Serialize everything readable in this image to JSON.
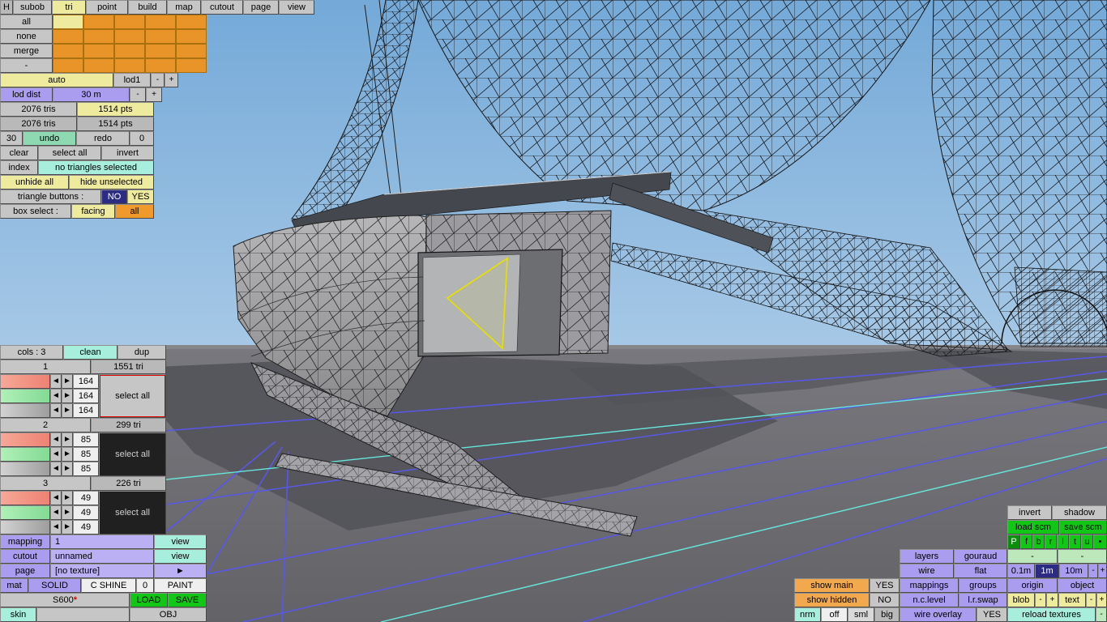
{
  "colors": {
    "sky": "#79add9",
    "ground": "#6a6a6f",
    "accent_orange": "#ef9a2a",
    "accent_violet": "#aa9cee",
    "accent_yellow": "#efeb9e",
    "accent_cyan": "#a8eedd",
    "accent_green": "#12c616",
    "selection_yellow": "#e6df00",
    "grid_blue": "#5858e8",
    "grid_cyan": "#66e6dc"
  },
  "menu": {
    "h": "H",
    "items": [
      "subob",
      "tri",
      "point",
      "build",
      "map",
      "cutout",
      "page",
      "view"
    ]
  },
  "subobj": {
    "buttons": [
      "all",
      "none",
      "merge",
      "-"
    ]
  },
  "lod": {
    "auto": "auto",
    "level": "lod1",
    "minus": "-",
    "plus": "+",
    "dist_label": "lod dist",
    "dist_value": "30 m"
  },
  "stats": {
    "row1": {
      "tris": "2076 tris",
      "pts": "1514 pts"
    },
    "row2": {
      "tris": "2076 tris",
      "pts": "1514 pts"
    }
  },
  "history": {
    "undo_count": "30",
    "undo": "undo",
    "redo": "redo",
    "redo_count": "0"
  },
  "selection": {
    "clear": "clear",
    "select_all": "select all",
    "invert": "invert",
    "index": "index",
    "status": "no triangles selected",
    "unhide_all": "unhide all",
    "hide_unselected": "hide unselected",
    "triangle_buttons_label": "triangle buttons :",
    "no": "NO",
    "yes": "YES",
    "box_select_label": "box select :",
    "facing": "facing",
    "all": "all"
  },
  "groups_panel": {
    "cols": "cols : 3",
    "clean": "clean",
    "dup": "dup",
    "arrow_left": "◄",
    "arrow_right": "►",
    "groups": [
      {
        "id": "1",
        "tri": "1551 tri",
        "values": [
          "164",
          "164",
          "164"
        ],
        "select_all": "select all"
      },
      {
        "id": "2",
        "tri": "299 tri",
        "values": [
          "85",
          "85",
          "85"
        ],
        "select_all": "select all"
      },
      {
        "id": "3",
        "tri": "226 tri",
        "values": [
          "49",
          "49",
          "49"
        ],
        "select_all": "select all"
      }
    ]
  },
  "mapping_rows": {
    "mapping_label": "mapping",
    "mapping_value": "1",
    "view": "view",
    "cutout_label": "cutout",
    "cutout_value": "unnamed",
    "page_label": "page",
    "page_value": "[no texture]",
    "page_arrow": "►",
    "mat_label": "mat",
    "mat_solid": "SOLID",
    "mat_cshine": "C SHINE",
    "mat_zero": "0",
    "mat_paint": "PAINT",
    "model_name": "S600",
    "model_star": "*",
    "load": "LOAD",
    "save": "SAVE",
    "skin_label": "skin",
    "obj": "OBJ"
  },
  "right_panel": {
    "invert": "invert",
    "shadow": "shadow",
    "load_scm": "load scm",
    "save_scm": "save scm",
    "view_buttons": [
      "P",
      "f",
      "b",
      "r",
      "l",
      "t",
      "u",
      "•"
    ],
    "layers": "layers",
    "gouraud": "gouraud",
    "dash1": "-",
    "dash2": "-",
    "wire": "wire",
    "flat": "flat",
    "g01": "0.1m",
    "g1": "1m",
    "g10": "10m",
    "gminus": "-",
    "gplus": "+",
    "show_main": "show main",
    "show_main_val": "YES",
    "mappings": "mappings",
    "groups": "groups",
    "origin": "origin",
    "object": "object",
    "show_hidden": "show hidden",
    "show_hidden_val": "NO",
    "nclevel": "n.c.level",
    "lrswap": "l.r.swap",
    "blob": "blob",
    "blob_minus": "-",
    "blob_plus": "+",
    "text": "text",
    "text_minus": "-",
    "text_plus": "+",
    "nrm": "nrm",
    "off": "off",
    "sml": "sml",
    "big": "big",
    "wire_overlay": "wire overlay",
    "wire_overlay_val": "YES",
    "reload_textures": "reload textures",
    "reload_dash": "-"
  }
}
